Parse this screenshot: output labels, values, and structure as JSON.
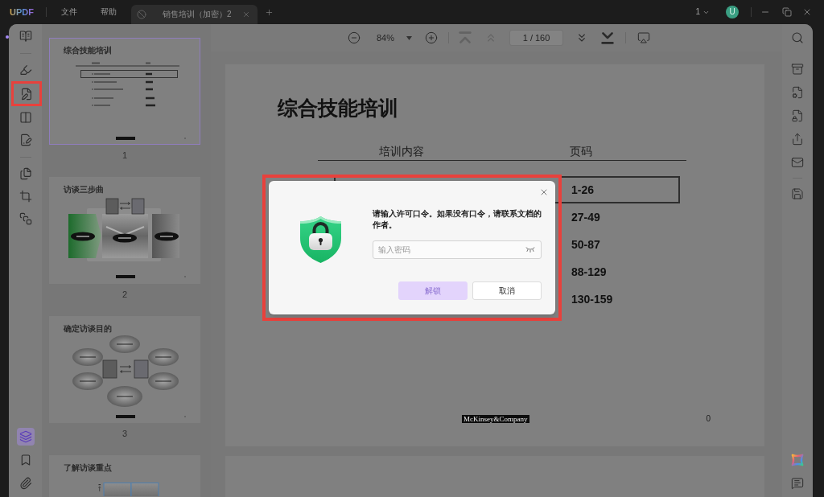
{
  "title_bar": {
    "logo": "UPDF",
    "menus": [
      {
        "label": "文件"
      },
      {
        "label": "帮助"
      }
    ],
    "tabs": [
      {
        "label": "销售培训（加密）2",
        "selected": true
      }
    ],
    "window_count": "1",
    "avatar": "U"
  },
  "left_sidebar": {
    "groups": [
      {
        "tools": [
          {
            "kind": "reader",
            "selected": false,
            "highlighted": false
          }
        ]
      },
      {
        "tools": [
          {
            "kind": "comment",
            "selected": false,
            "highlighted": false
          },
          {
            "kind": "edit",
            "selected": false,
            "highlighted": true
          },
          {
            "kind": "organize",
            "selected": false,
            "highlighted": false
          },
          {
            "kind": "fill-sign",
            "selected": false,
            "highlighted": false
          }
        ]
      },
      {
        "tools": [
          {
            "kind": "pages",
            "selected": false,
            "highlighted": false
          },
          {
            "kind": "crop",
            "selected": false,
            "highlighted": false
          },
          {
            "kind": "compare",
            "selected": false,
            "highlighted": false
          }
        ]
      }
    ],
    "bottom_tools": [
      {
        "kind": "layers",
        "selected": true,
        "highlighted": false
      },
      {
        "kind": "bookmark",
        "selected": false,
        "highlighted": false
      },
      {
        "kind": "attachment",
        "selected": false,
        "highlighted": false
      }
    ]
  },
  "thumbnails": [
    {
      "kind": "contents",
      "title": "综合技能培训",
      "label": "1",
      "selected": true
    },
    {
      "kind": "process",
      "title": "访谈三步曲",
      "label": "2",
      "selected": false
    },
    {
      "kind": "goals",
      "title": "确定访谈目的",
      "label": "3",
      "selected": false
    },
    {
      "kind": "table",
      "title": "了解访谈重点",
      "selected": false
    }
  ],
  "toolbar": {
    "zoom": "84%",
    "page_field": "1 / 160",
    "navigation": [
      {
        "kind": "first",
        "disabled": true
      },
      {
        "kind": "previous",
        "disabled": true
      },
      {
        "kind": "next",
        "disabled": false
      },
      {
        "kind": "last",
        "disabled": false
      }
    ]
  },
  "document": {
    "title": "综合技能培训",
    "columns": [
      {
        "label": "培训内容"
      },
      {
        "label": "页码"
      }
    ],
    "rows": [
      {
        "pages": "1-26",
        "boxed": true
      },
      {
        "pages": "27-49",
        "boxed": false
      },
      {
        "pages": "50-87",
        "boxed": false
      },
      {
        "pages": "88-129",
        "boxed": false
      },
      {
        "pages": "130-159",
        "boxed": false
      }
    ],
    "footer_logo": "McKinsey&Company",
    "page_number": "0"
  },
  "dialog": {
    "highlighted": true,
    "message": "请输入许可口令。如果没有口令，请联系文档的作者。",
    "password": {
      "placeholder": "输入密码"
    },
    "buttons": [
      {
        "kind": "primary",
        "label": "解锁",
        "disabled": true
      },
      {
        "kind": "secondary",
        "label": "取消",
        "disabled": false
      }
    ]
  }
}
